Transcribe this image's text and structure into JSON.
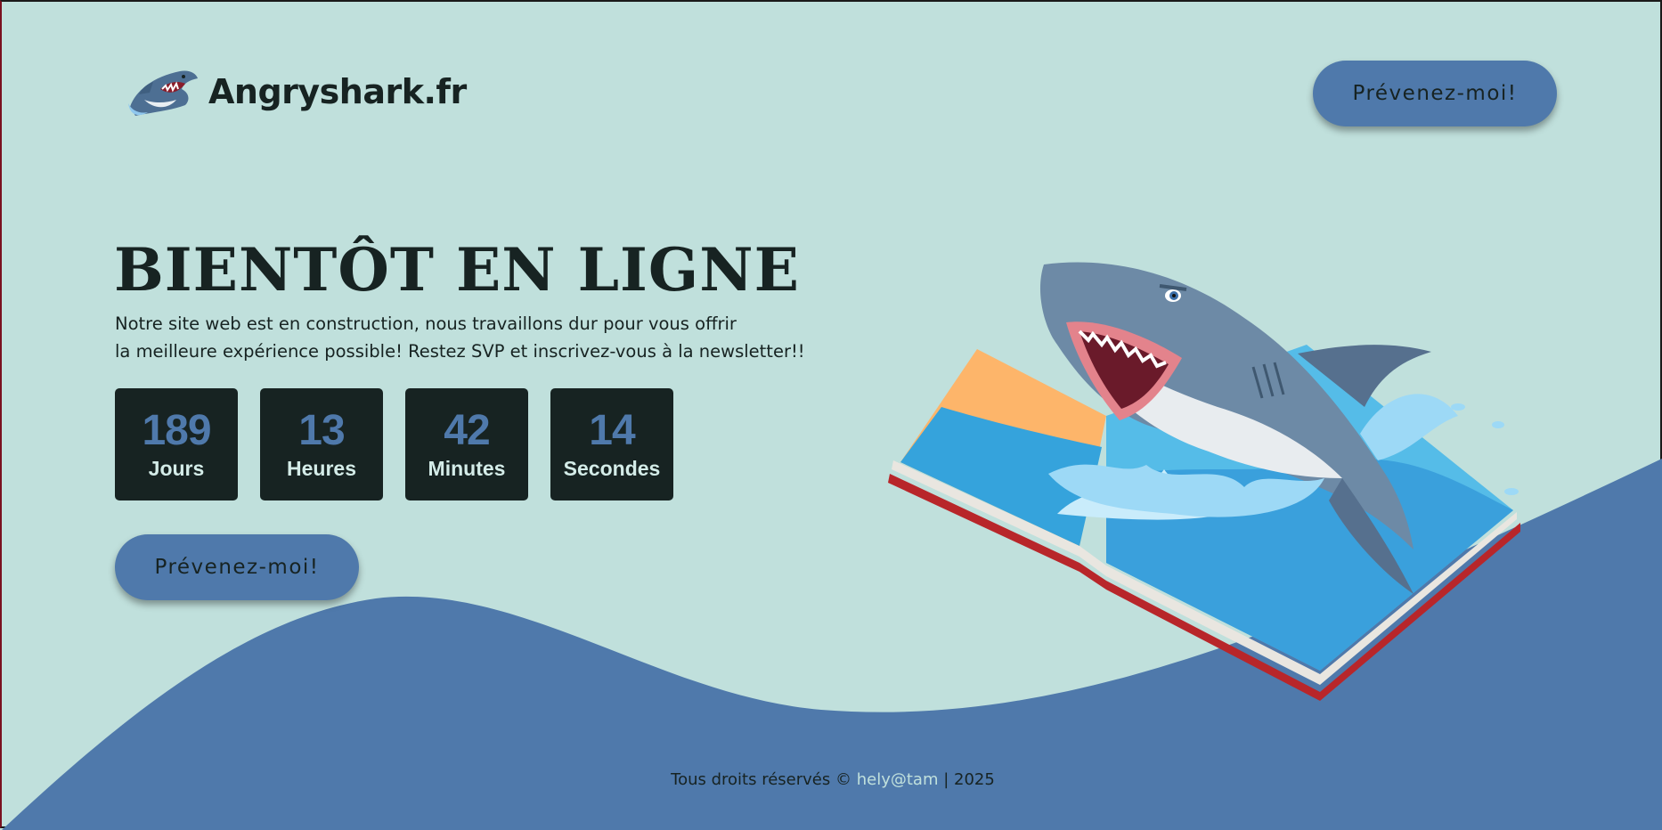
{
  "brand": {
    "name": "Angryshark.fr",
    "logo_icon": "shark-logo-icon"
  },
  "header": {
    "notify_button": "Prévenez-moi!"
  },
  "hero": {
    "title": "BIENTÔT EN LIGNE",
    "description_line1": "Notre site web est en construction, nous travaillons dur pour vous offrir",
    "description_line2": "la meilleure expérience possible! Restez SVP et inscrivez-vous à la newsletter!!",
    "cta_button": "Prévenez-moi!"
  },
  "countdown": [
    {
      "value": "189",
      "label": "Jours"
    },
    {
      "value": "13",
      "label": "Heures"
    },
    {
      "value": "42",
      "label": "Minutes"
    },
    {
      "value": "14",
      "label": "Secondes"
    }
  ],
  "illustration": {
    "icon": "shark-book-illustration-icon"
  },
  "footer": {
    "prefix": "Tous droits réservés ©",
    "author": "hely@tam",
    "suffix": "| 2025"
  },
  "colors": {
    "background": "#c0e0dc",
    "wave": "#4f79ab",
    "dark": "#172322",
    "accent": "#4f79ab"
  }
}
